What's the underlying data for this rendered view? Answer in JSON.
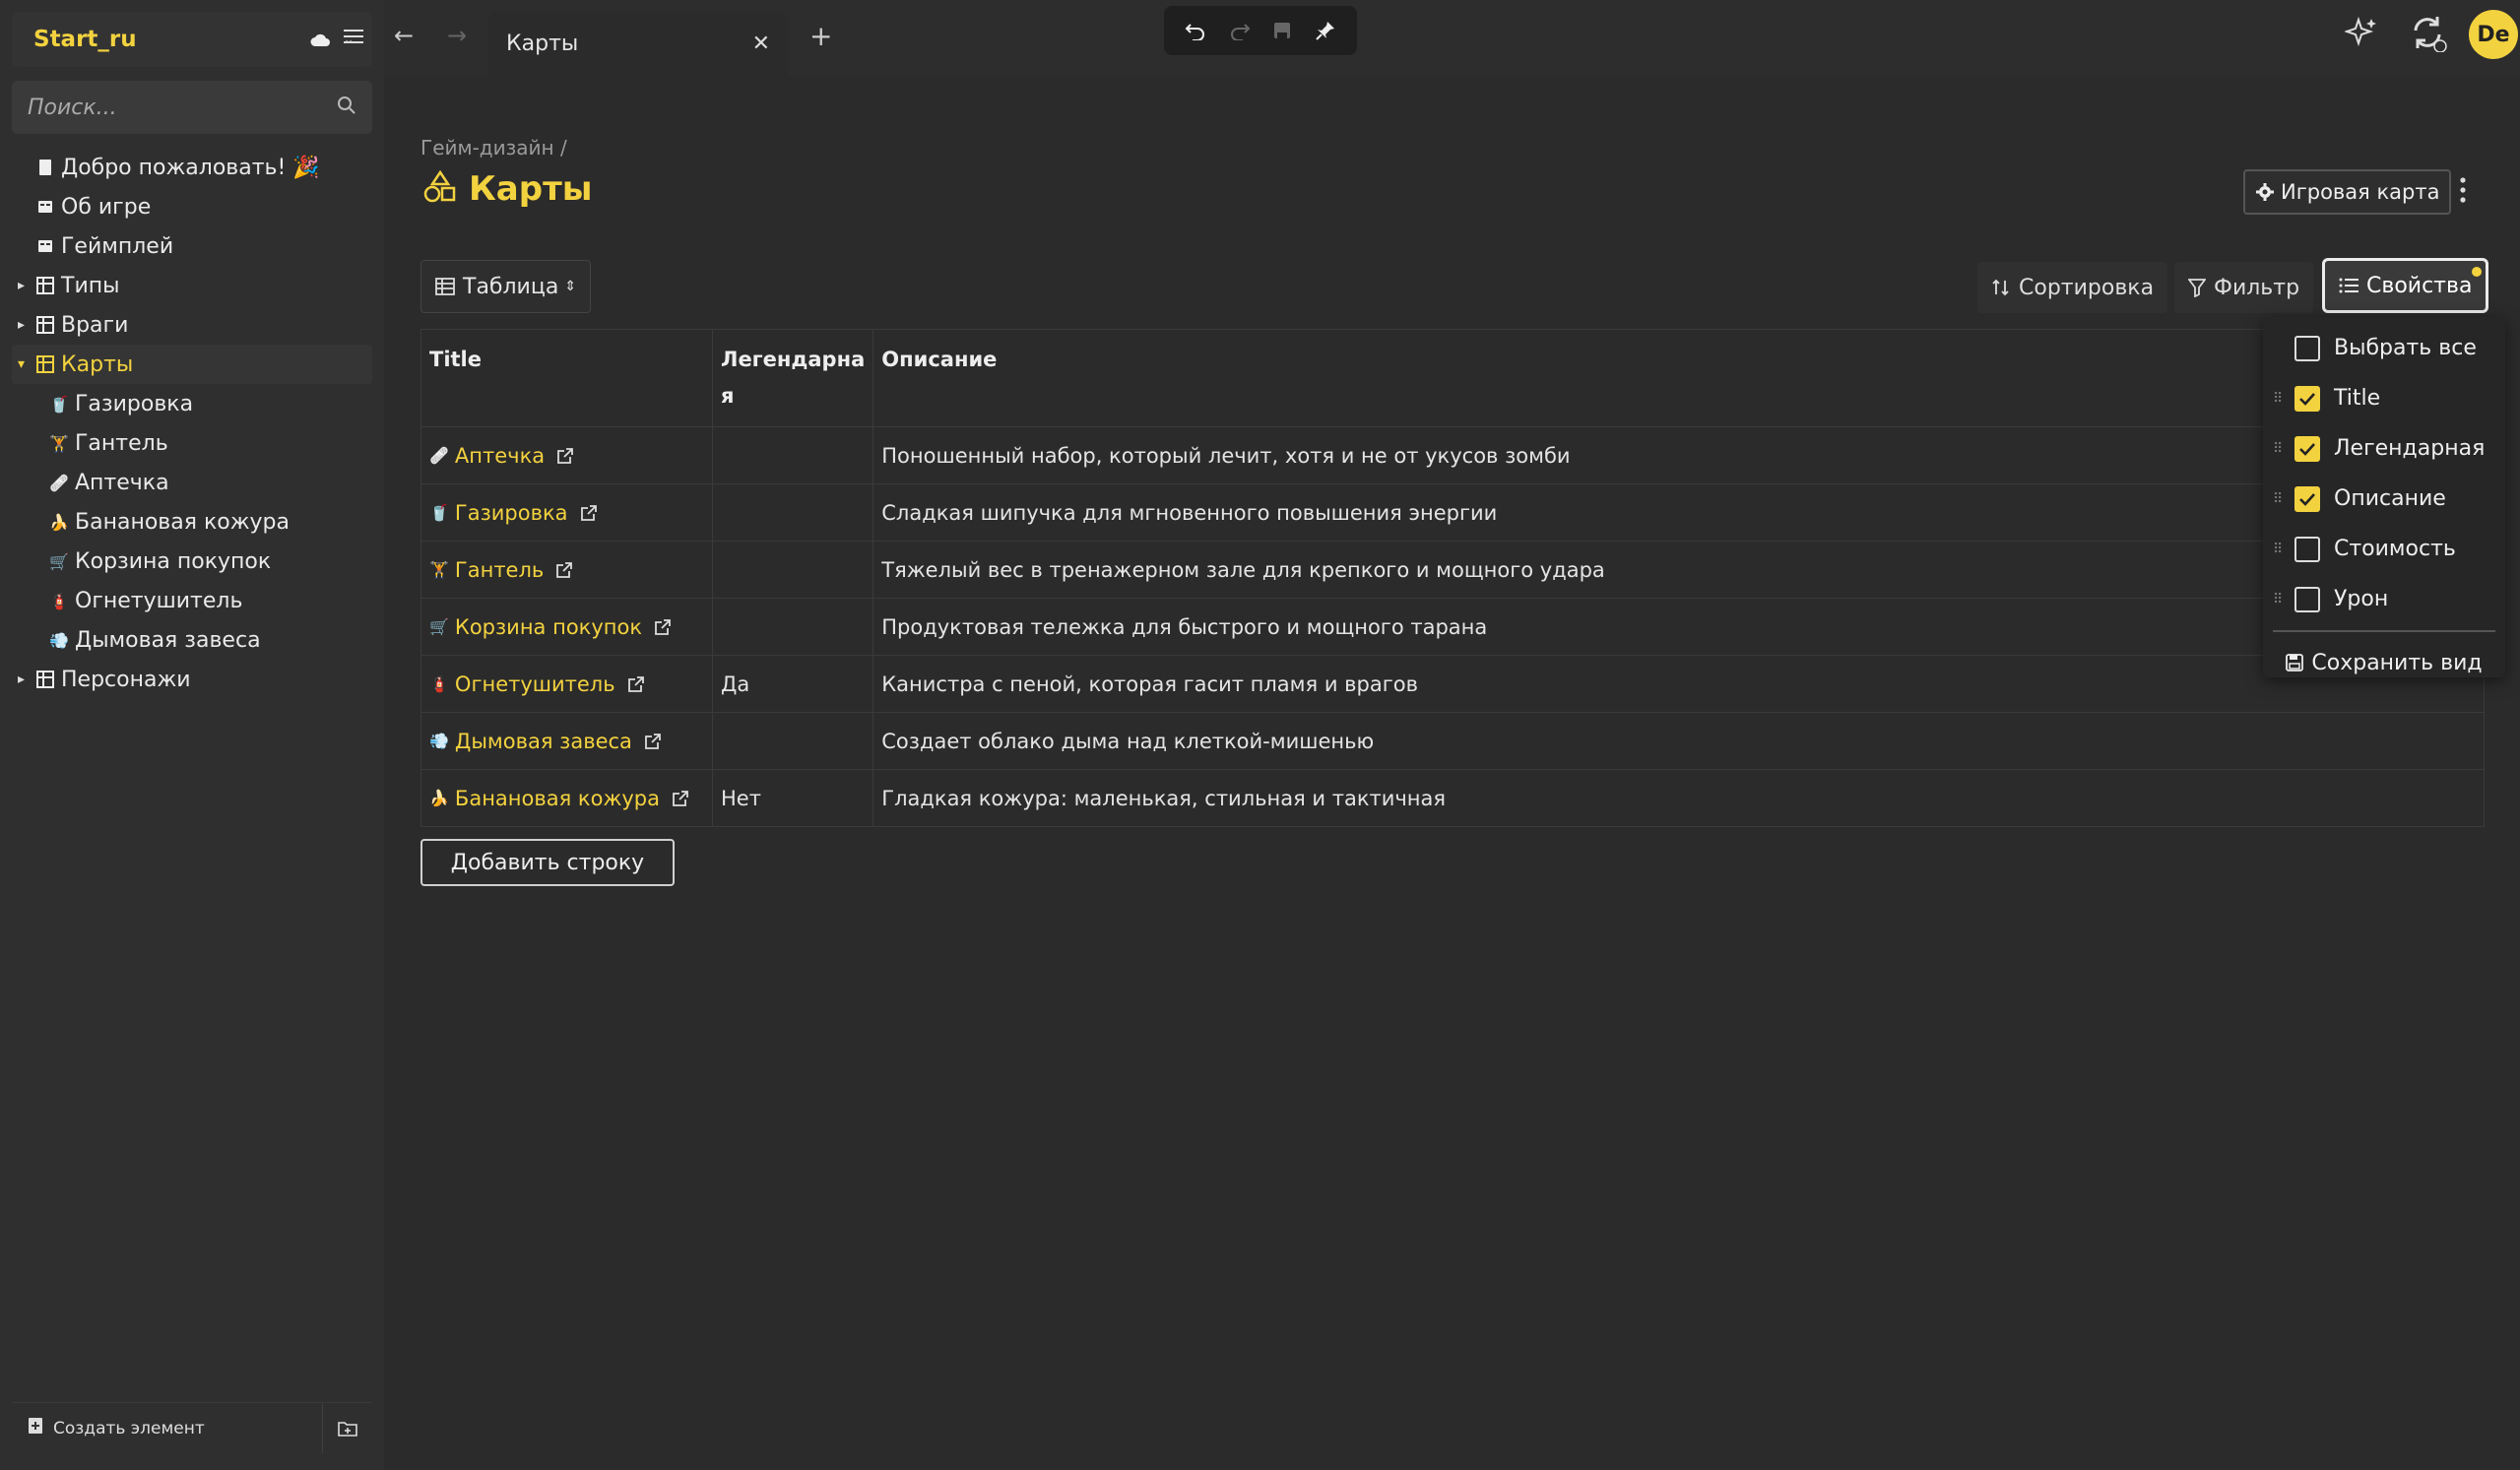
{
  "workspace": {
    "name": "Start_ru"
  },
  "search": {
    "placeholder": "Поиск..."
  },
  "sidebar": {
    "items": [
      {
        "label": "Добро пожаловать! 🎉",
        "icon": "page-icon"
      },
      {
        "label": "Об игре",
        "icon": "doc-icon"
      },
      {
        "label": "Геймплей",
        "icon": "doc-icon"
      },
      {
        "label": "Типы",
        "icon": "database-icon"
      },
      {
        "label": "Враги",
        "icon": "database-icon"
      },
      {
        "label": "Карты",
        "icon": "database-icon"
      },
      {
        "label": "Газировка",
        "icon": "soda-icon"
      },
      {
        "label": "Гантель",
        "icon": "dumbbell-icon"
      },
      {
        "label": "Аптечка",
        "icon": "medkit-icon"
      },
      {
        "label": "Банановая кожура",
        "icon": "banana-icon"
      },
      {
        "label": "Корзина покупок",
        "icon": "cart-icon"
      },
      {
        "label": "Огнетушитель",
        "icon": "extinguisher-icon"
      },
      {
        "label": "Дымовая завеса",
        "icon": "smoke-icon"
      },
      {
        "label": "Персонажи",
        "icon": "database-icon"
      }
    ],
    "create_label": "Создать элемент"
  },
  "tab": {
    "label": "Карты"
  },
  "breadcrumb": "Гейм-дизайн /",
  "page": {
    "title": "Карты",
    "game_map_button": "Игровая карта"
  },
  "view": {
    "label": "Таблица"
  },
  "controls": {
    "sort": "Сортировка",
    "filter": "Фильтр",
    "properties": "Свойства"
  },
  "avatar": "De",
  "table": {
    "headers": [
      "Title",
      "Легендарна я",
      "Описание"
    ],
    "rows": [
      {
        "title": "Аптечка",
        "emoji": "🩹",
        "legendary": "",
        "description": "Поношенный набор, который лечит, хотя и не от укусов зомби"
      },
      {
        "title": "Газировка",
        "emoji": "🥤",
        "legendary": "",
        "description": "Сладкая шипучка для мгновенного повышения энергии"
      },
      {
        "title": "Гантель",
        "emoji": "🏋",
        "legendary": "",
        "description": "Тяжелый вес в тренажерном зале для крепкого и мощного удара"
      },
      {
        "title": "Корзина покупок",
        "emoji": "🛒",
        "legendary": "",
        "description": "Продуктовая тележка для быстрого и мощного тарана"
      },
      {
        "title": "Огнетушитель",
        "emoji": "🧯",
        "legendary": "Да",
        "description": "Канистра с пеной, которая гасит пламя и врагов"
      },
      {
        "title": "Дымовая завеса",
        "emoji": "💨",
        "legendary": "",
        "description": "Создает облако дыма над клеткой-мишенью"
      },
      {
        "title": "Банановая кожура",
        "emoji": "🍌",
        "legendary": "Нет",
        "description": "Гладкая кожура: маленькая, стильная и тактичная"
      }
    ],
    "add_row": "Добавить строку"
  },
  "properties_menu": {
    "select_all": "Выбрать все",
    "items": [
      {
        "label": "Title",
        "checked": true
      },
      {
        "label": "Легендарная",
        "checked": true
      },
      {
        "label": "Описание",
        "checked": true
      },
      {
        "label": "Стоимость",
        "checked": false
      },
      {
        "label": "Урон",
        "checked": false
      }
    ],
    "save_view": "Сохранить вид"
  },
  "colors": {
    "accent": "#f3d23f",
    "background": "#2b2b2b",
    "sidebar": "#2f2f2f"
  }
}
